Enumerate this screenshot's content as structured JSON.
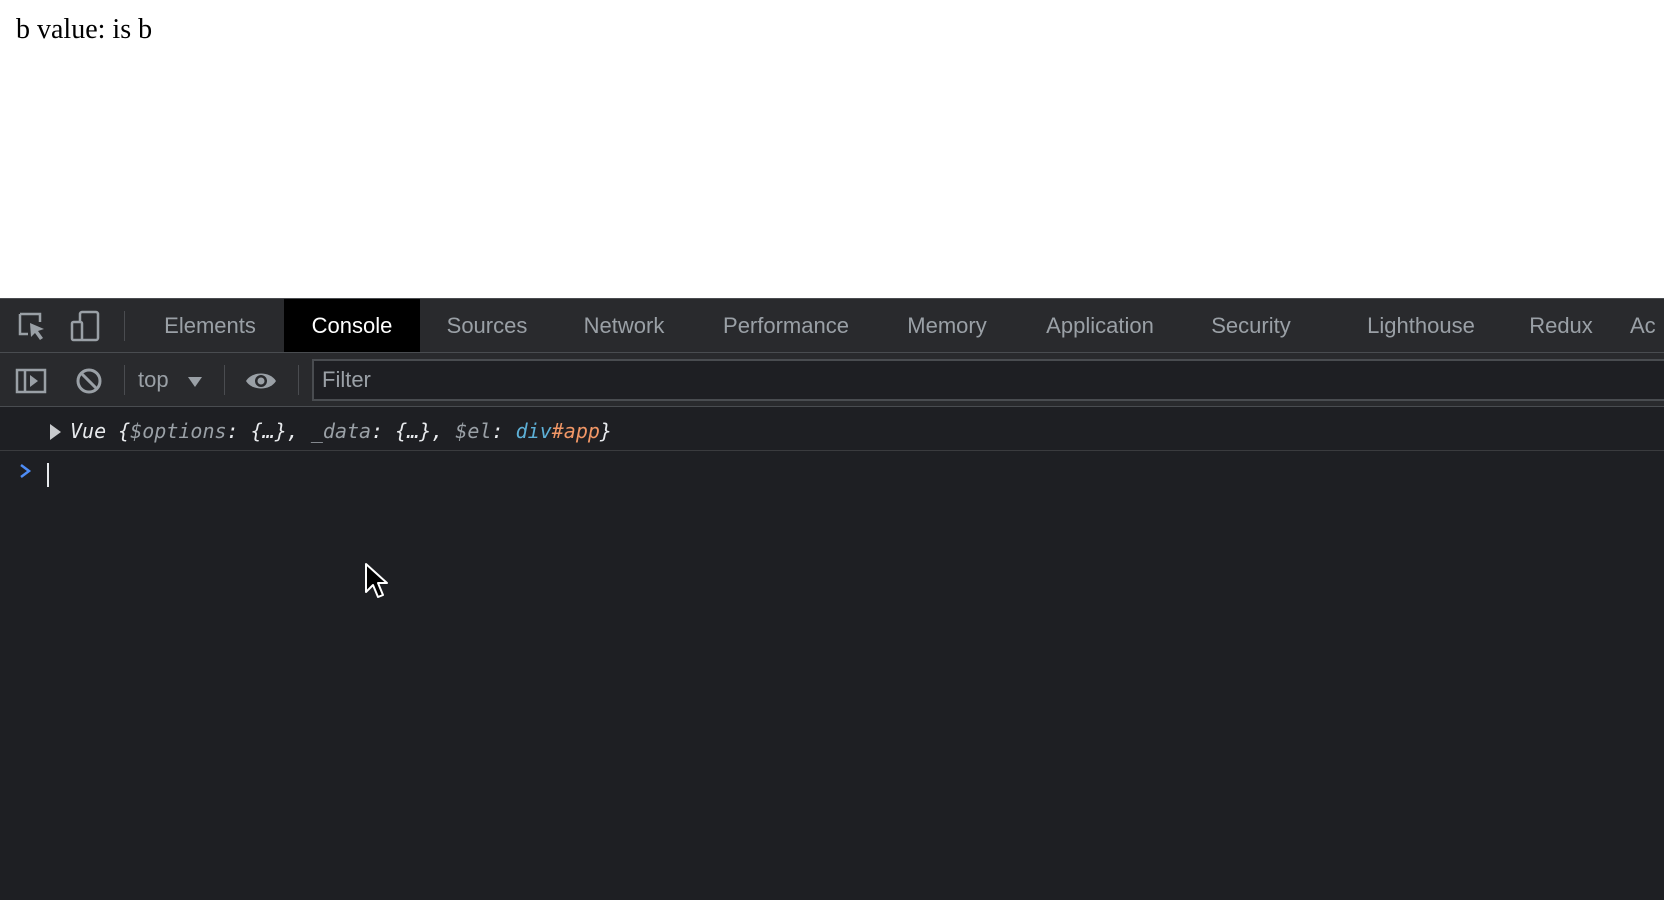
{
  "page": {
    "text": "b value: is b"
  },
  "devtools": {
    "tabs": [
      {
        "label": "Elements",
        "active": false
      },
      {
        "label": "Console",
        "active": true
      },
      {
        "label": "Sources",
        "active": false
      },
      {
        "label": "Network",
        "active": false
      },
      {
        "label": "Performance",
        "active": false
      },
      {
        "label": "Memory",
        "active": false
      },
      {
        "label": "Application",
        "active": false
      },
      {
        "label": "Security",
        "active": false
      },
      {
        "label": "Lighthouse",
        "active": false
      },
      {
        "label": "Redux",
        "active": false
      },
      {
        "label": "Ac",
        "active": false
      }
    ],
    "toolbar_icons": {
      "inspect": "inspect-element-icon",
      "device": "device-toolbar-icon"
    }
  },
  "console": {
    "toolbar": {
      "sidebar_icon": "sidebar-toggle-icon",
      "clear_icon": "clear-console-icon",
      "context": "top",
      "eye_icon": "live-expression-icon",
      "filter_placeholder": "Filter"
    },
    "log": {
      "class_name": "Vue",
      "open_brace": "{",
      "k1": "$options",
      "v1": "{…}",
      "k2": "_data",
      "v2": "{…}",
      "k3": "$el",
      "v3_tag": "div",
      "v3_id": "#app",
      "close_brace": "}",
      "colon": ": ",
      "comma": ", "
    },
    "prompt": {
      "value": ""
    }
  },
  "colors": {
    "devtools_bg": "#1e1f23",
    "toolbar_bg": "#292a2d",
    "active_tab_bg": "#000000",
    "prompt_chevron": "#4e8df7",
    "tag_color": "#5db0d7",
    "id_color": "#f29766"
  }
}
